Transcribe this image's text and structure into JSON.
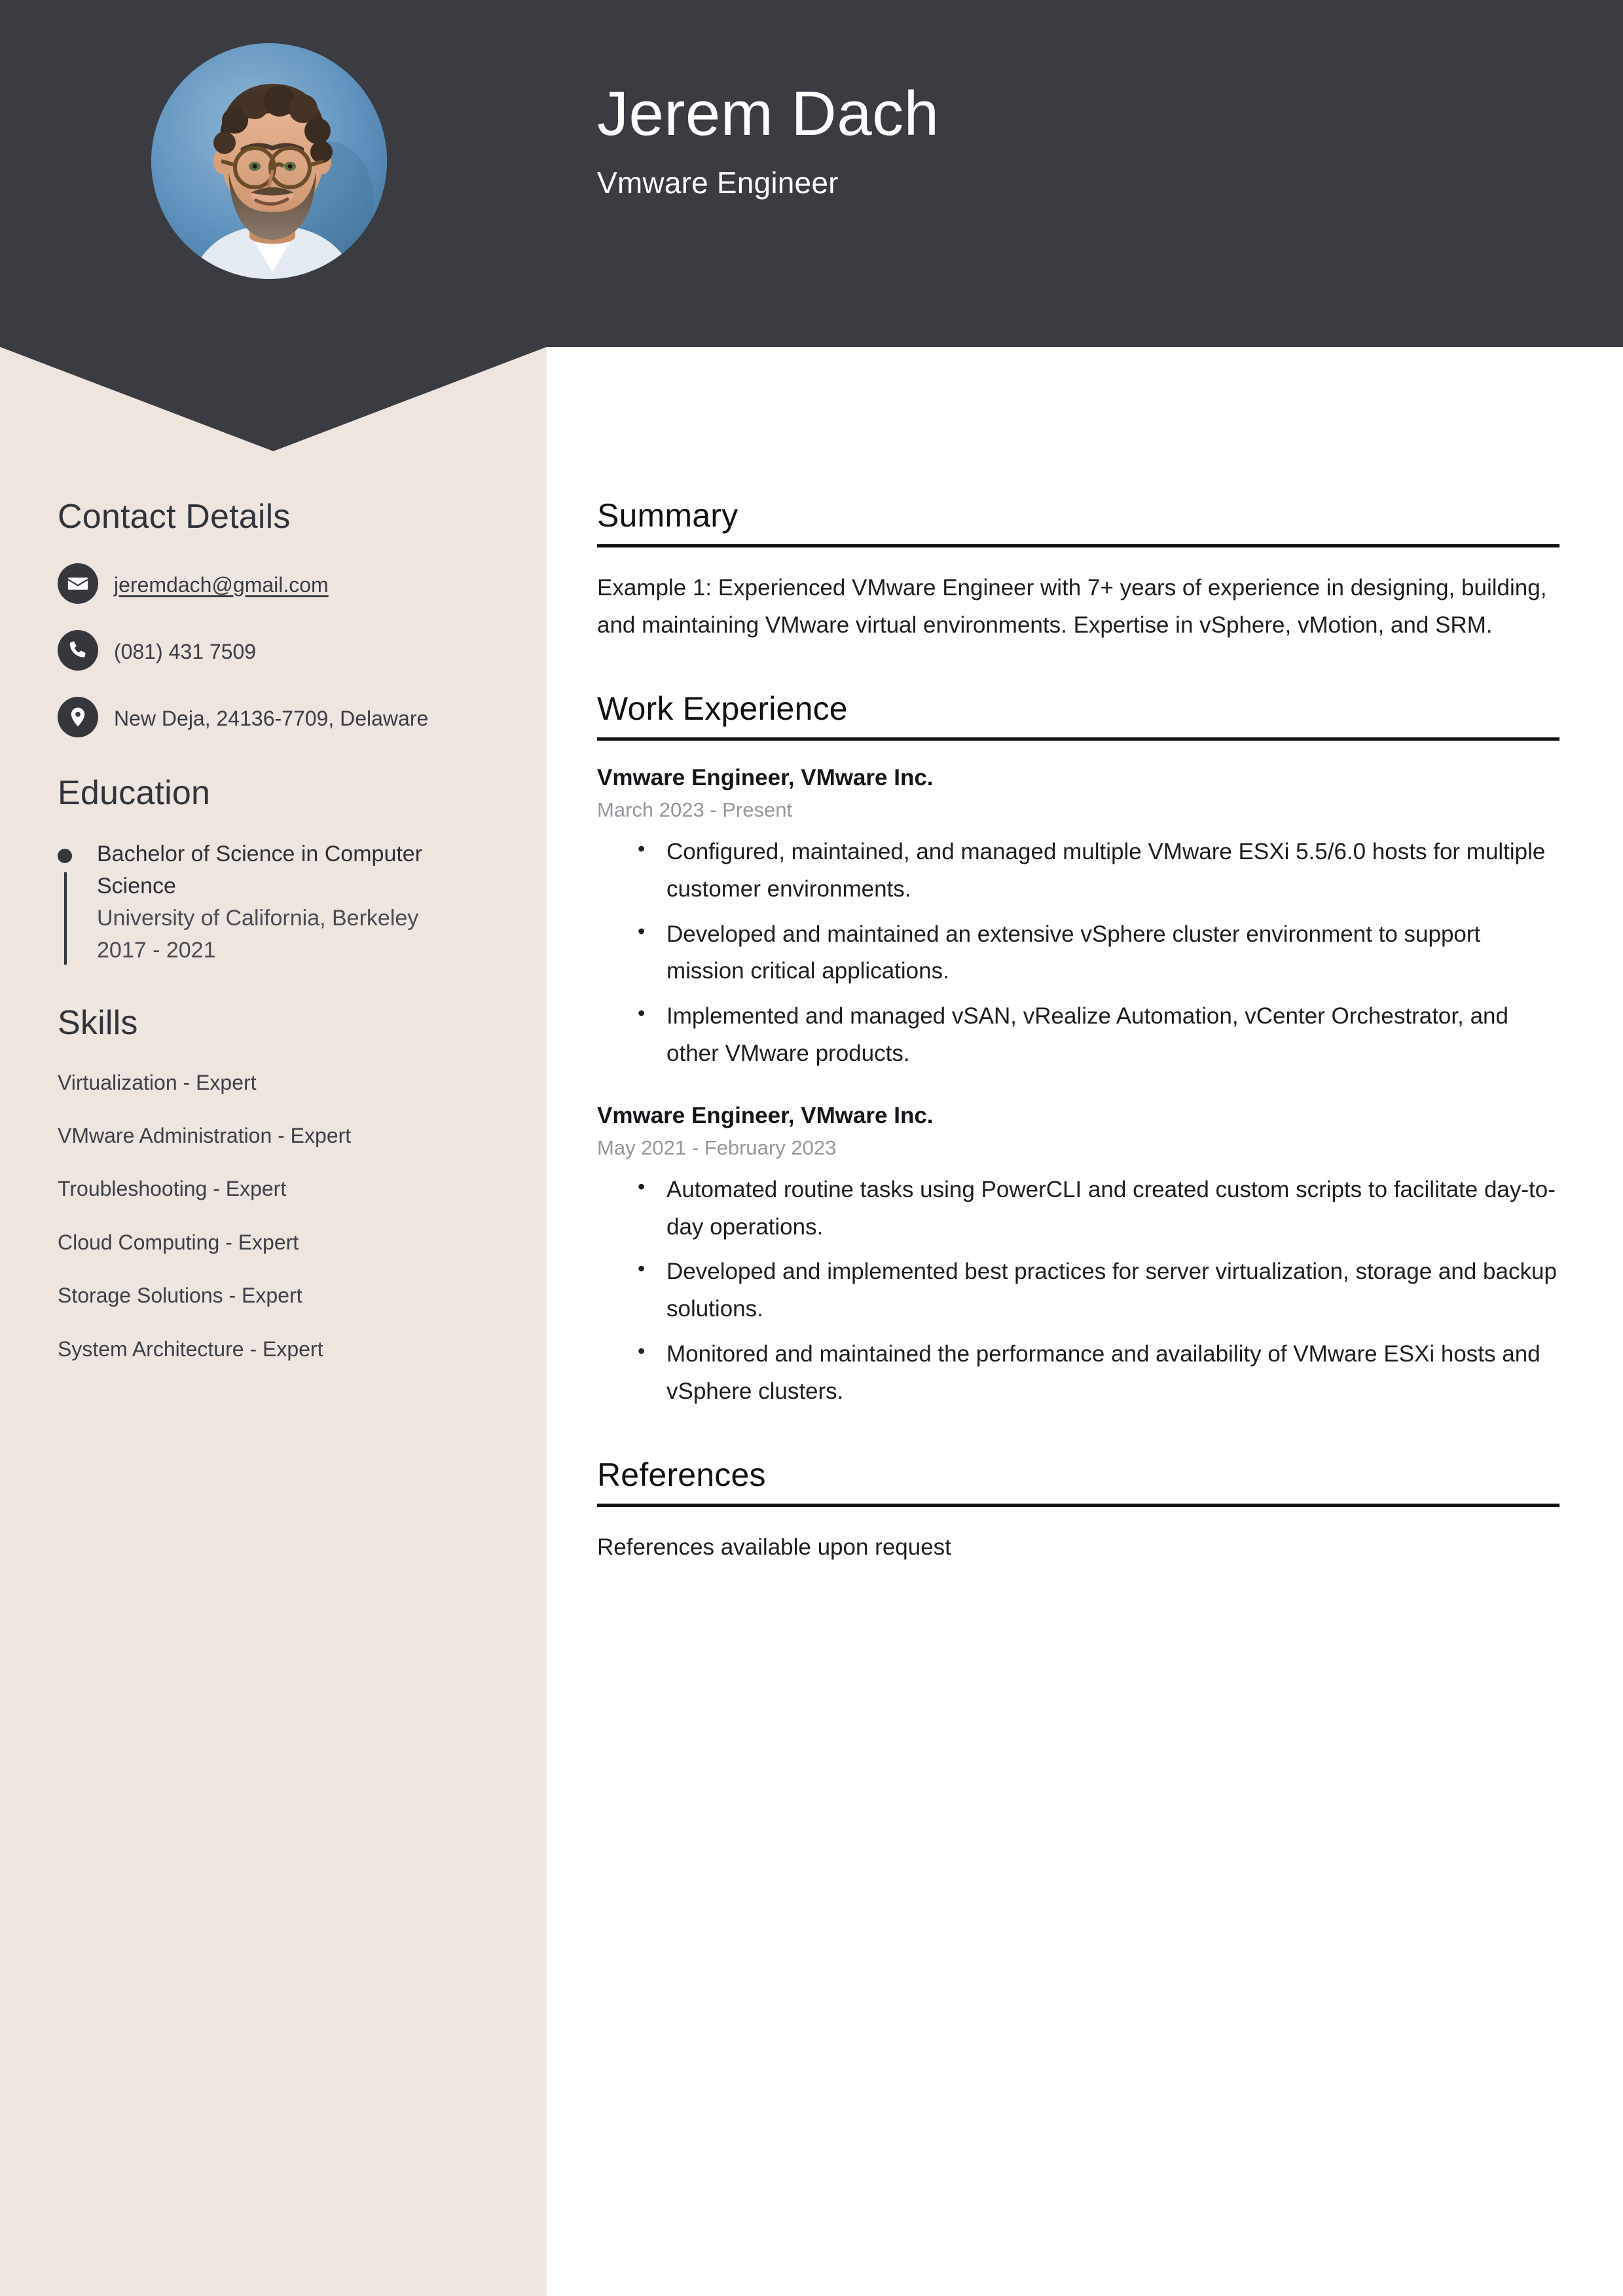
{
  "colors": {
    "header_dark": "#3A3C42",
    "sidebar_beige": "#EEE5DF",
    "page_white": "#FFFFFF",
    "text_dark": "#1D1E22",
    "date_gray": "#95979C"
  },
  "header": {
    "name": "Jerem Dach",
    "title": "Vmware Engineer",
    "avatar_alt": "profile-photo"
  },
  "sidebar": {
    "contact": {
      "heading": "Contact Details",
      "items": [
        {
          "icon": "envelope-icon",
          "value": "jeremdach@gmail.com",
          "is_link": true
        },
        {
          "icon": "phone-icon",
          "value": "(081) 431 7509",
          "is_link": false
        },
        {
          "icon": "location-pin-icon",
          "value": "New Deja, 24136-7709, Delaware",
          "is_link": false
        }
      ]
    },
    "education": {
      "heading": "Education",
      "items": [
        {
          "degree": "Bachelor of Science in Computer Science",
          "school": "University of California, Berkeley",
          "dates": "2017 - 2021"
        }
      ]
    },
    "skills": {
      "heading": "Skills",
      "items": [
        "Virtualization - Expert",
        "VMware Administration - Expert",
        "Troubleshooting - Expert",
        "Cloud Computing - Expert",
        "Storage Solutions - Expert",
        "System Architecture - Expert"
      ]
    }
  },
  "main": {
    "summary": {
      "heading": "Summary",
      "text": "Example 1: Experienced VMware Engineer with 7+ years of experience in designing, building, and maintaining VMware virtual environments. Expertise in vSphere, vMotion, and SRM."
    },
    "work_experience": {
      "heading": "Work Experience",
      "jobs": [
        {
          "title": "Vmware Engineer, VMware Inc.",
          "dates": "March 2023 - Present",
          "bullets": [
            "Configured, maintained, and managed multiple VMware ESXi 5.5/6.0 hosts for multiple customer environments.",
            "Developed and maintained an extensive vSphere cluster environment to support mission critical applications.",
            "Implemented and managed vSAN, vRealize Automation, vCenter Orchestrator, and other VMware products."
          ]
        },
        {
          "title": "Vmware Engineer, VMware Inc.",
          "dates": "May 2021 - February 2023",
          "bullets": [
            "Automated routine tasks using PowerCLI and created custom scripts to facilitate day-to-day operations.",
            "Developed and implemented best practices for server virtualization, storage and backup solutions.",
            "Monitored and maintained the performance and availability of VMware ESXi hosts and vSphere clusters."
          ]
        }
      ]
    },
    "references": {
      "heading": "References",
      "text": "References available upon request"
    }
  }
}
